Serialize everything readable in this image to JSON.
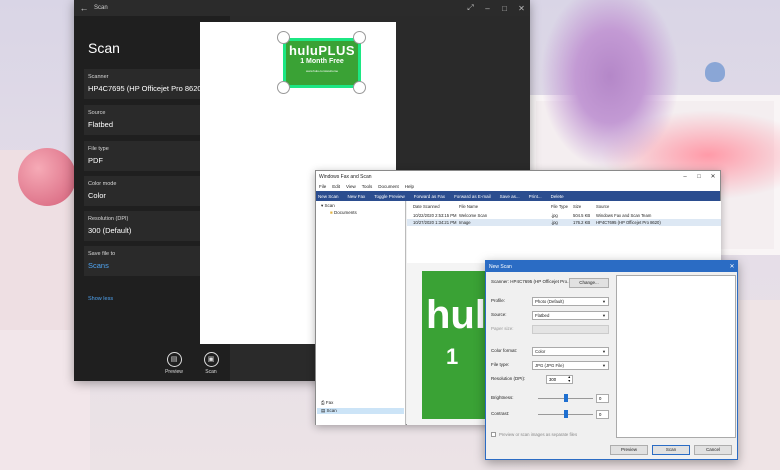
{
  "scan_app": {
    "title": "Scan",
    "heading": "Scan",
    "fields": [
      {
        "label": "Scanner",
        "value": "HP4C7695 (HP Officejet Pro 8620"
      },
      {
        "label": "Source",
        "value": "Flatbed"
      },
      {
        "label": "File type",
        "value": "PDF"
      },
      {
        "label": "Color mode",
        "value": "Color"
      },
      {
        "label": "Resolution (DPI)",
        "value": "300 (Default)"
      },
      {
        "label": "Save file to",
        "value": "Scans"
      }
    ],
    "show_less": "Show less",
    "actions": {
      "preview": "Preview",
      "scan": "Scan"
    },
    "preview_badge": {
      "line1": "huluPLUS",
      "line2": "1 Month Free",
      "line3": "www.hulu.com/welcome"
    }
  },
  "wfs": {
    "title": "Windows Fax and Scan",
    "menu": [
      "File",
      "Edit",
      "View",
      "Tools",
      "Document",
      "Help"
    ],
    "toolbar": [
      "New Scan",
      "New Fax",
      "Toggle Preview",
      "Forward as Fax",
      "Forward as E-mail",
      "Save as...",
      "Print...",
      "Delete"
    ],
    "tree": {
      "root": "Scan",
      "child": "Documents",
      "fax": "Fax",
      "scan": "Scan"
    },
    "columns": [
      "Date Scanned",
      "File Name",
      "File Type",
      "Size",
      "Source"
    ],
    "rows": [
      [
        "10/22/2020 2:53:15 PM",
        "Welcome Scan",
        ".jpg",
        "504.5 KB",
        "Windows Fax and Scan Team"
      ],
      [
        "10/27/2020 1:34:21 PM",
        "Image",
        ".jpg",
        "176.2 KB",
        "HP4C7695 (HP Officejet Pro 8620)"
      ]
    ],
    "preview_text": {
      "line1": "hul",
      "line2": "1"
    }
  },
  "new_scan": {
    "title": "New Scan",
    "scanner_label": "Scanner: HP4C7695 (HP Officejet Pro...",
    "change_button": "Change...",
    "profile_label": "Profile:",
    "profile_value": "Photo (Default)",
    "source_label": "Source:",
    "source_value": "Flatbed",
    "paper_size_label": "Paper size:",
    "color_format_label": "Color format:",
    "color_format_value": "Color",
    "file_type_label": "File type:",
    "file_type_value": "JPG (JPG File)",
    "resolution_label": "Resolution (DPI):",
    "resolution_value": "300",
    "brightness_label": "Brightness:",
    "brightness_value": "0",
    "brightness_level": 0.5,
    "contrast_label": "Contrast:",
    "contrast_value": "0",
    "contrast_level": 0.5,
    "checkbox_label": "Preview or scan images as separate files",
    "buttons": {
      "preview": "Preview",
      "scan": "Scan",
      "cancel": "Cancel"
    }
  }
}
